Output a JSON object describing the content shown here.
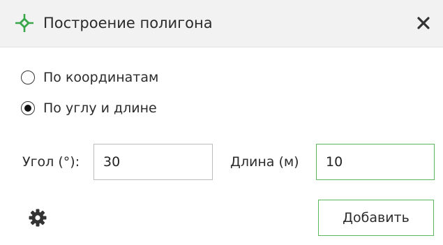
{
  "dialog": {
    "title": "Построение полигона",
    "title_icon": "polygon-crosshair-icon",
    "close_icon": "close-icon"
  },
  "mode": {
    "options": [
      {
        "label": "По координатам",
        "checked": false
      },
      {
        "label": "По углу и длине",
        "checked": true
      }
    ]
  },
  "fields": {
    "angle_label": "Угол (°):",
    "angle_value": "30",
    "length_label": "Длина (м)",
    "length_value": "10"
  },
  "footer": {
    "settings_icon": "gear-icon",
    "add_label": "Добавить"
  },
  "colors": {
    "accent_green": "#5cb85c",
    "title_icon_green": "#3aa64a",
    "titlebar_bg": "#f2f2f2"
  }
}
